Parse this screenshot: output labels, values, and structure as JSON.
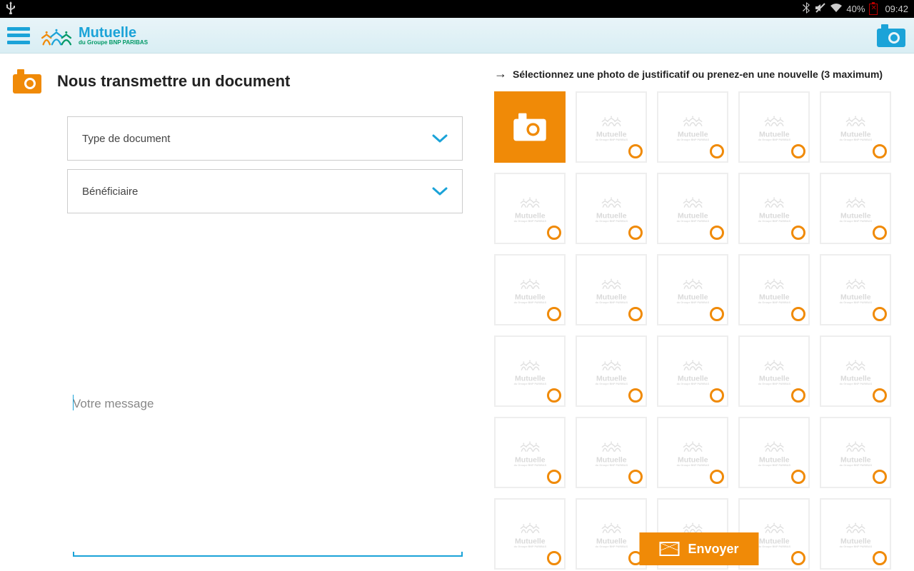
{
  "status_bar": {
    "battery_pct": "40%",
    "time": "09:42"
  },
  "header": {
    "brand_main": "Mutuelle",
    "brand_sub": "du Groupe BNP PARIBAS"
  },
  "left": {
    "title": "Nous transmettre un document",
    "dropdown_type": "Type de document",
    "dropdown_beneficiary": "Bénéficiaire",
    "message_placeholder": "Votre message"
  },
  "right": {
    "instruction": "Sélectionnez une photo de justificatif ou prenez-en une nouvelle (3 maximum)",
    "send_label": "Envoyer"
  },
  "placeholder": {
    "main": "Mutuelle",
    "sub": "du Groupe BNP PARIBAS"
  },
  "grid": {
    "rows": 6,
    "cols": 5,
    "capture_first": true
  }
}
